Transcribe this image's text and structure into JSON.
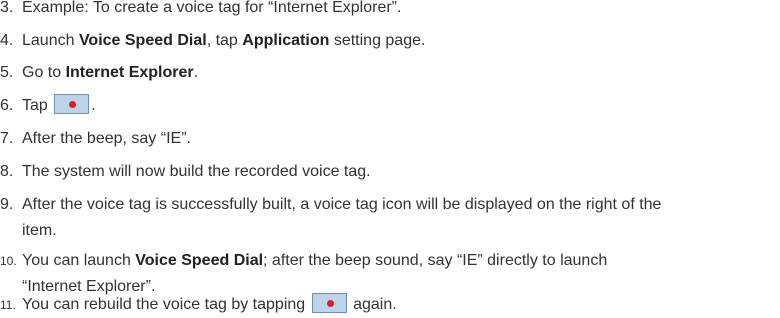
{
  "colors": {
    "text": "#333333",
    "record_button_fill": "#bcd3ea",
    "record_button_border": "#6e8fb0",
    "record_dot": "#e21b1b"
  },
  "items": [
    {
      "num": "3.",
      "text": "Example: To create a voice tag for “Internet Explorer”."
    },
    {
      "num": "4.",
      "t1": "Launch ",
      "b1": "Voice Speed Dial",
      "t2": ", tap ",
      "b2": "Application",
      "t3": " setting page."
    },
    {
      "num": "5.",
      "t1": "Go to ",
      "b1": "Internet Explorer",
      "t2": "."
    },
    {
      "num": "6.",
      "t1": "Tap ",
      "icon": "record-button-icon",
      "t2": "."
    },
    {
      "num": "7.",
      "text": "After the beep, say “IE”."
    },
    {
      "num": "8.",
      "text": "The system will now build the recorded voice tag."
    },
    {
      "num": "9.",
      "line1": "After the voice tag is successfully built, a voice tag icon will be displayed on the right of the",
      "line2": "item."
    },
    {
      "num": "10.",
      "t1": "You can launch ",
      "b1": "Voice Speed Dial",
      "t2": "; after the beep sound, say “IE” directly to launch",
      "line2": "“Internet Explorer”."
    },
    {
      "num": "11.",
      "t1": "You can rebuild the voice tag by tapping ",
      "icon": "record-button-icon",
      "t2": " again."
    }
  ]
}
